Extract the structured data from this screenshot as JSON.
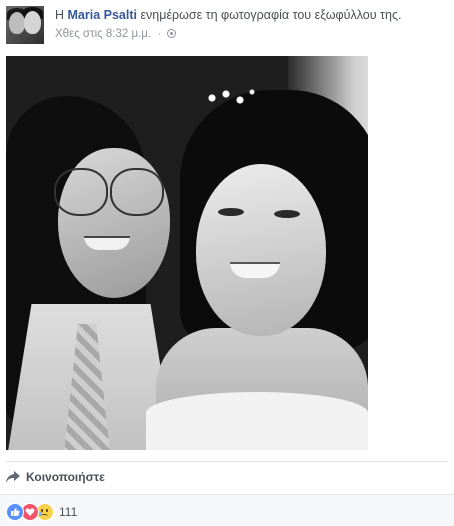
{
  "post": {
    "header": {
      "prefix": "Η",
      "author": "Maria Psalti",
      "action": "ενημέρωσε τη φωτογραφία του εξωφύλλου της.",
      "timestamp": "Χθες στις 8:32 μ.μ.",
      "separator": "·",
      "privacy_icon": "globe-icon"
    },
    "photo": {
      "kind": "black-and-white wedding portrait"
    },
    "actions": {
      "share_label": "Κοινοποιήστε",
      "share_icon": "share-arrow-icon"
    },
    "reactions": {
      "icons": [
        "like-icon",
        "love-icon",
        "sad-icon"
      ],
      "count": "111"
    }
  },
  "colors": {
    "author_link": "#365899",
    "meta_text": "#90949c",
    "like": "#5890ff",
    "love": "#f25268",
    "sad": "#f7d14c"
  }
}
